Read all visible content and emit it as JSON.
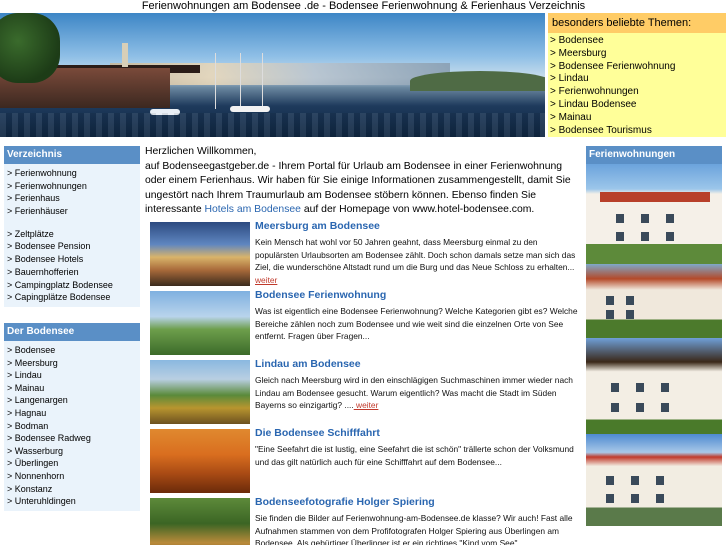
{
  "page_title": "Ferienwohnungen am Bodensee .de - Bodensee Ferienwohnung & Ferienhaus Verzeichnis",
  "themes": {
    "heading": "besonders beliebte Themen:",
    "items": [
      "Bodensee",
      "Meersburg",
      "Bodensee Ferienwohnung",
      "Lindau",
      "Ferienwohnungen",
      "Lindau Bodensee",
      "Mainau",
      "Bodensee Tourismus"
    ]
  },
  "verzeichnis": {
    "heading": "Verzeichnis",
    "group1": [
      "Ferienwohnung",
      "Ferienwohnungen",
      "Ferienhaus",
      "Ferienhäuser"
    ],
    "group2": [
      "Zeltplätze",
      "Bodensee Pension",
      "Bodensee Hotels",
      "Bauernhofferien",
      "Campingplatz Bodensee",
      "Capingplätze Bodensee"
    ]
  },
  "der_bodensee": {
    "heading": "Der Bodensee",
    "items": [
      "Bodensee",
      "Meersburg",
      "Lindau",
      "Mainau",
      "Langenargen",
      "Hagnau",
      "Bodman",
      "Bodensee Radweg",
      "Wasserburg",
      "Überlingen",
      "Nonnenhorn",
      "Konstanz",
      "Unteruhldingen"
    ]
  },
  "welcome": {
    "line1": "Herzlichen Willkommen,",
    "line2_pre": "auf Bodenseegastgeber.de - Ihrem Portal für Urlaub am Bodensee in einer Ferienwohnung oder einem Ferienhaus. Wir haben für Sie einige Informationen zusammengestellt, damit Sie ungestört nach Ihrem Traumurlaub am Bodensee stöbern können. Ebenso finden Sie interessante ",
    "link": "Hotels am Bodensee",
    "line2_post": " auf der Homepage von www.hotel-bodensee.com."
  },
  "articles": [
    {
      "title": "Meersburg am Bodensee",
      "text": "Kein Mensch hat wohl vor 50 Jahren geahnt, dass Meersburg einmal zu den populärsten Urlaubsorten am Bodensee zählt. Doch schon damals setze man sich das Ziel, die wunderschöne Altstadt rund um die Burg und das Neue Schloss zu erhalten...",
      "more": " weiter"
    },
    {
      "title": "Bodensee Ferienwohnung",
      "text": "Was ist eigentlich eine Bodensee Ferienwohnung? Welche Kategorien gibt es? Welche Bereiche zählen noch zum Bodensee und wie weit sind die einzelnen Orte von See entfernt. Fragen über Fragen...",
      "more": ""
    },
    {
      "title": "Lindau am Bodensee",
      "text": "Gleich nach Meersburg wird in den einschlägigen Suchmaschinen immer wieder nach Lindau am Bodensee gesucht. Warum eigentlich? Was macht die Stadt im Süden Bayerns so einzigartig? ....",
      "more": " weiter"
    },
    {
      "title": "Die Bodensee Schifffahrt",
      "text": "\"Eine Seefahrt die ist lustig, eine Seefahrt die ist schön\" trällerte schon der Volksmund und das gilt natürlich auch für eine Schifffahrt auf dem Bodensee...",
      "more": ""
    },
    {
      "title": "Bodenseefotografie Holger Spiering",
      "text": "Sie finden die Bilder auf Ferienwohnung-am-Bodensee.de klasse? Wir auch! Fast alle Aufnahmen stammen von dem Profifotografen Holger Spiering aus Überlingen am Bodensee. Als gebürtiger Überlinger ist er ein richtiges \"Kind vom See\"...",
      "more": ""
    }
  ],
  "right_column": {
    "heading": "Ferienwohnungen"
  },
  "nav_prefix": "> "
}
